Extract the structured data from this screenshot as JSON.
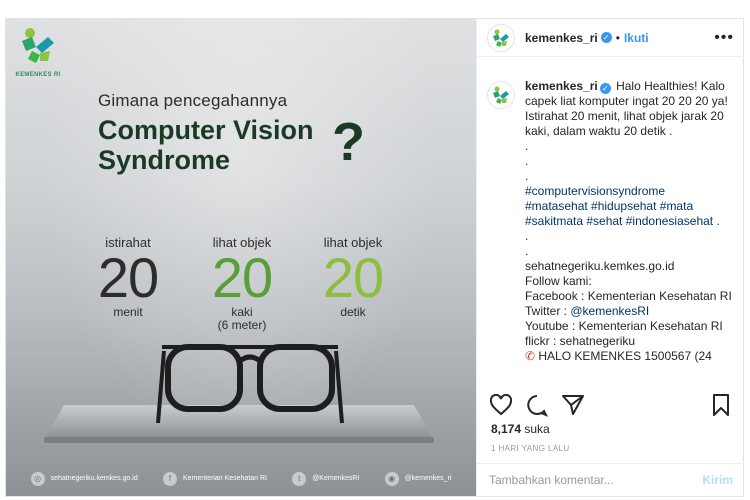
{
  "image": {
    "logo_text": "KEMENKES RI",
    "subtitle": "Gimana pencegahannya",
    "headline_line1": "Computer Vision",
    "headline_line2": "Syndrome",
    "question_mark": "?",
    "stats": [
      {
        "label": "istirahat",
        "number": "20",
        "unit1": "menit",
        "unit2": "",
        "color": "#2d2d2d"
      },
      {
        "label": "lihat objek",
        "number": "20",
        "unit1": "kaki",
        "unit2": "(6 meter)",
        "color": "#5a9e3a"
      },
      {
        "label": "lihat objek",
        "number": "20",
        "unit1": "detik",
        "unit2": "",
        "color": "#8cbf3f"
      }
    ],
    "footer": [
      {
        "icon": "globe-icon",
        "text": "sehatnegeriku.kemkes.go.id"
      },
      {
        "icon": "facebook-icon",
        "text": "Kementerian Kesehatan RI"
      },
      {
        "icon": "twitter-icon",
        "text": "@KemenkesRI"
      },
      {
        "icon": "instagram-icon",
        "text": "@kemenkes_ri"
      }
    ]
  },
  "header": {
    "username": "kemenkes_ri",
    "separator": "•",
    "follow_label": "Ikuti",
    "more_label": "•••"
  },
  "caption": {
    "username": "kemenkes_ri",
    "intro": "Halo Healthies! Kalo capek liat komputer ingat 20 20 20 ya! Istirahat 20 menit, lihat objek jarak 20 kaki, dalam waktu 20 detik .",
    "dots": [
      ".",
      ".",
      "."
    ],
    "hashtags_line1": "#computervisionsyndrome",
    "hashtags_line2": "#matasehat #hidupsehat #mata",
    "hashtags_line3": "#sakitmata #sehat #indonesiasehat .",
    "dots2": [
      ".",
      "."
    ],
    "website": "sehatnegeriku.kemkes.go.id",
    "follow_us": "Follow kami:",
    "facebook": "Facebook : Kementerian Kesehatan RI",
    "twitter_prefix": "Twitter : ",
    "twitter_handle": "@kemenkesRI",
    "youtube": "Youtube : Kementerian Kesehatan RI",
    "flickr": "flickr : sehatnegeriku",
    "halo": "HALO KEMENKES 1500567 (24"
  },
  "likes": {
    "count": "8,174",
    "label": "suka"
  },
  "timestamp": "1 HARI YANG LALU",
  "comment": {
    "placeholder": "Tambahkan komentar...",
    "post_label": "Kirim"
  },
  "colors": {
    "accent_blue": "#3897f0",
    "dark_green": "#1a3a26",
    "mid_green": "#5a9e3a",
    "light_green": "#8cbf3f"
  }
}
